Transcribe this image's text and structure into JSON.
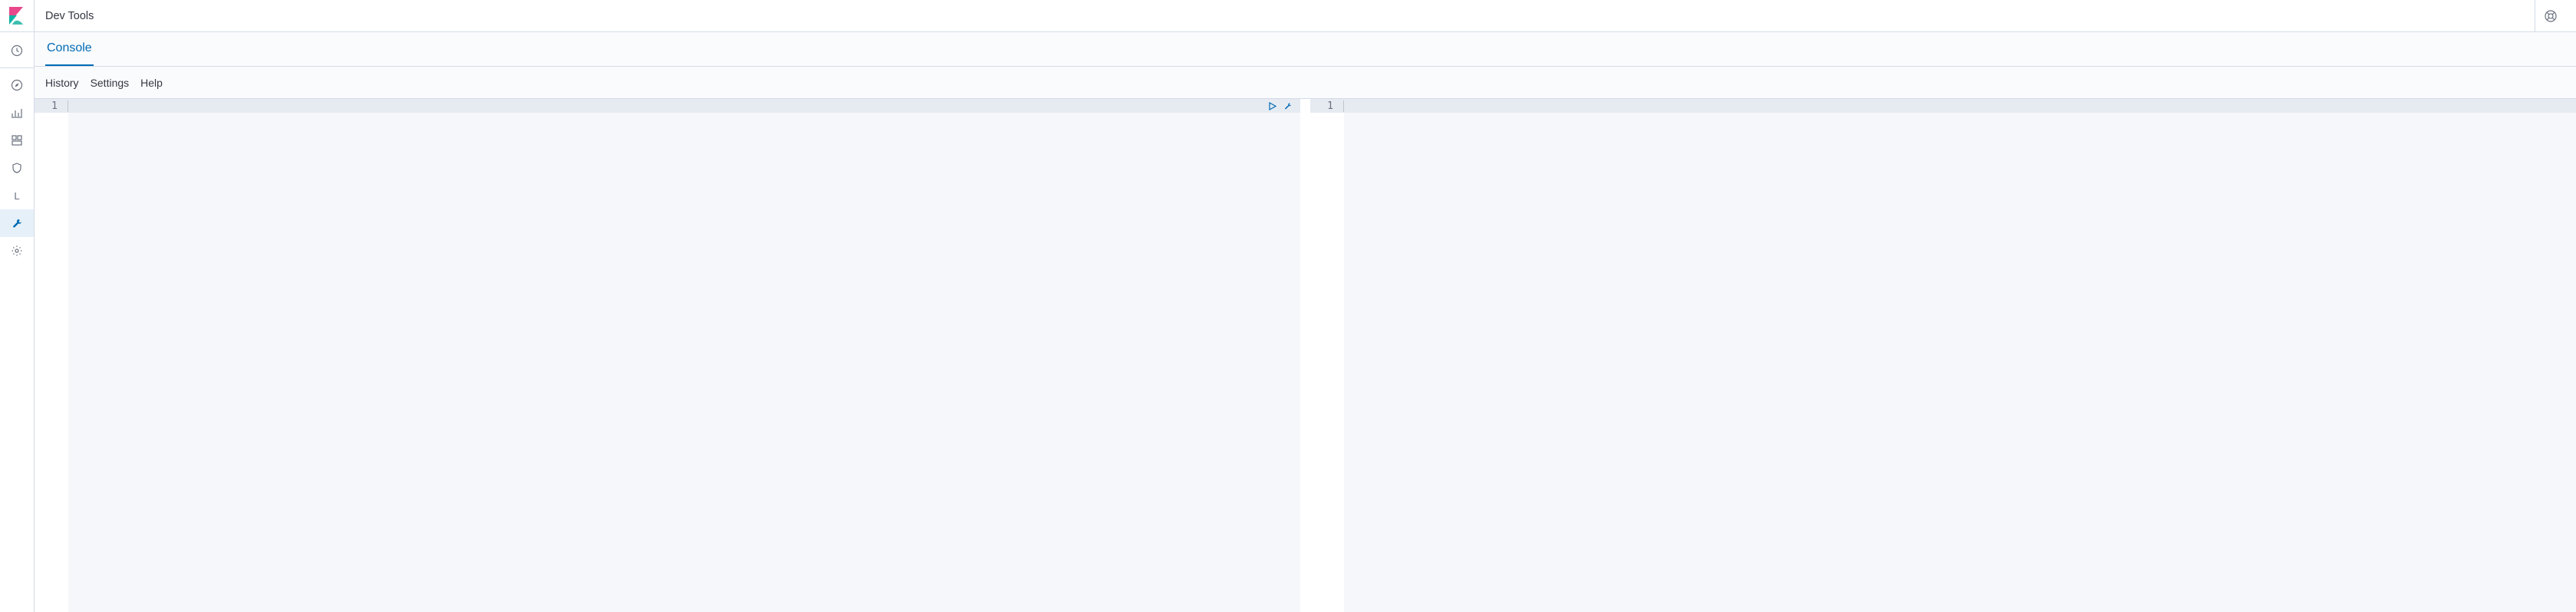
{
  "sidebar": {
    "logo": "kibana-logo"
  },
  "header": {
    "title": "Dev Tools"
  },
  "tabs": {
    "items": [
      {
        "label": "Console"
      }
    ],
    "active_index": 0
  },
  "toolbar": {
    "history": "History",
    "settings": "Settings",
    "help": "Help"
  },
  "editors": {
    "left": {
      "gutter": [
        "1"
      ]
    },
    "right": {
      "gutter": [
        "1"
      ]
    }
  },
  "nav_icons": {
    "letter": "L"
  }
}
